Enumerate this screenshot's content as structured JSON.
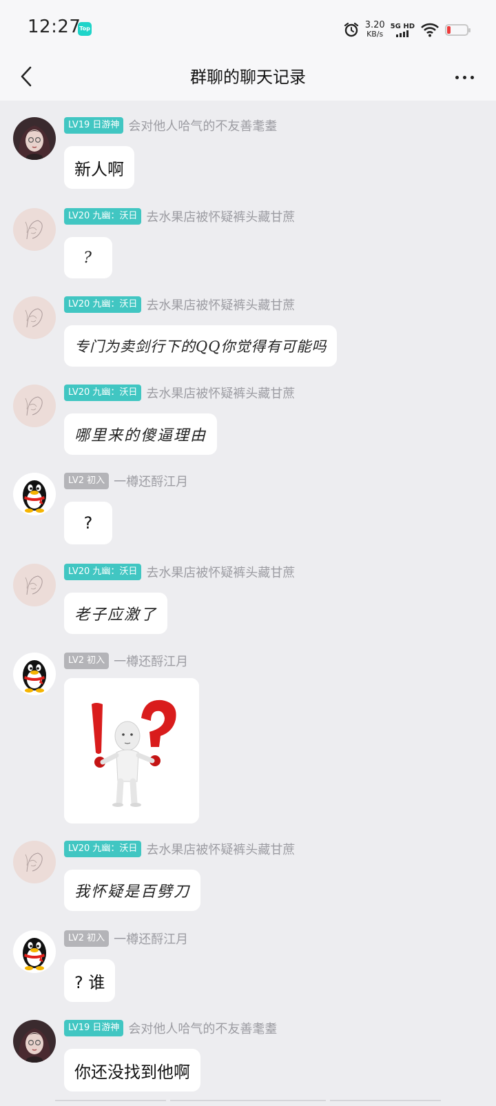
{
  "status_bar": {
    "time": "12:27",
    "app_badge": "Top",
    "net_speed": "3.20",
    "net_unit": "KB/s",
    "network": "5G HD"
  },
  "nav": {
    "title": "群聊的聊天记录"
  },
  "messages": [
    {
      "level": "LV19 日游神",
      "badge_color": "#41c6c2",
      "nickname": "会对他人哈气的不友善耄耋",
      "avatar": "girl-avatar",
      "text": "新人啊"
    },
    {
      "level": "LV20 九幽：沃日",
      "badge_color": "#41c6c2",
      "nickname": "去水果店被怀疑裤头藏甘蔗",
      "avatar": "sketch-avatar",
      "text": "?"
    },
    {
      "level": "LV20 九幽：沃日",
      "badge_color": "#41c6c2",
      "nickname": "去水果店被怀疑裤头藏甘蔗",
      "avatar": "sketch-avatar",
      "text": "专门为卖剑行下的QQ你觉得有可能吗"
    },
    {
      "level": "LV20 九幽：沃日",
      "badge_color": "#41c6c2",
      "nickname": "去水果店被怀疑裤头藏甘蔗",
      "avatar": "sketch-avatar",
      "text": "哪里来的傻逼理由"
    },
    {
      "level": "LV2 初入",
      "badge_color": "#b4b4b8",
      "nickname": "一樽还酹江月",
      "avatar": "penguin-avatar",
      "text": "?"
    },
    {
      "level": "LV20 九幽：沃日",
      "badge_color": "#41c6c2",
      "nickname": "去水果店被怀疑裤头藏甘蔗",
      "avatar": "sketch-avatar",
      "text": "老子应激了"
    },
    {
      "level": "LV2 初入",
      "badge_color": "#b4b4b8",
      "nickname": "一樽还酹江月",
      "avatar": "penguin-avatar",
      "image": "exclamation-question-sticker"
    },
    {
      "level": "LV20 九幽：沃日",
      "badge_color": "#41c6c2",
      "nickname": "去水果店被怀疑裤头藏甘蔗",
      "avatar": "sketch-avatar",
      "text": "我怀疑是百劈刀"
    },
    {
      "level": "LV2 初入",
      "badge_color": "#b4b4b8",
      "nickname": "一樽还酹江月",
      "avatar": "penguin-avatar",
      "text": "? 谁"
    },
    {
      "level": "LV19 日游神",
      "badge_color": "#41c6c2",
      "nickname": "会对他人哈气的不友善耄耋",
      "avatar": "girl-avatar",
      "text": "你还没找到他啊"
    }
  ]
}
